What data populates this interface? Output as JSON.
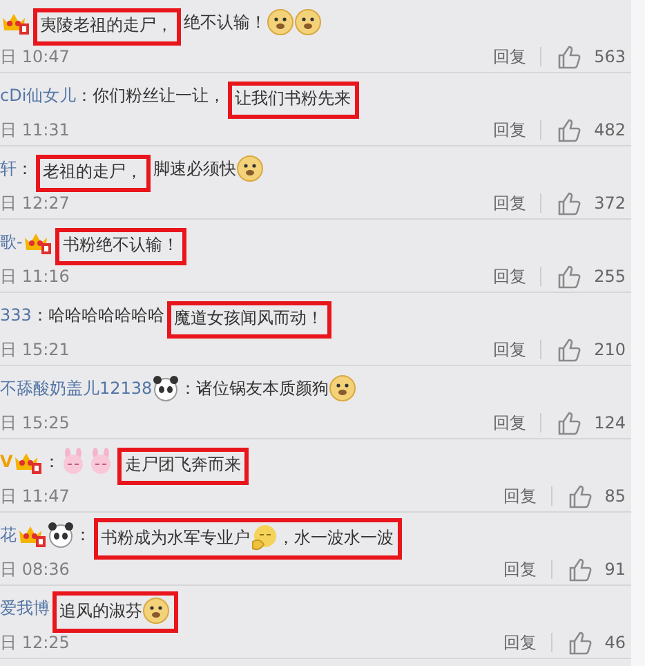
{
  "comments": [
    {
      "line": [
        {
          "highlighted": false,
          "items": [
            {
              "kind": "crown"
            }
          ]
        },
        {
          "highlighted": true,
          "items": [
            {
              "kind": "text",
              "text": "夷陵老祖的走尸，"
            }
          ]
        },
        {
          "highlighted": false,
          "items": [
            {
              "kind": "text",
              "text": "绝不认输！"
            },
            {
              "kind": "doge"
            },
            {
              "kind": "doge"
            }
          ]
        }
      ],
      "time": "日 10:47",
      "reply": "回复",
      "likes": "563"
    },
    {
      "line": [
        {
          "highlighted": false,
          "items": [
            {
              "kind": "user",
              "text": "cDi仙女儿"
            },
            {
              "kind": "text",
              "text": "：你们粉丝让一让，"
            }
          ]
        },
        {
          "highlighted": true,
          "items": [
            {
              "kind": "text",
              "text": "让我们书粉先来"
            }
          ]
        }
      ],
      "time": "日 11:31",
      "reply": "回复",
      "likes": "482"
    },
    {
      "line": [
        {
          "highlighted": false,
          "items": [
            {
              "kind": "user",
              "text": "轩"
            },
            {
              "kind": "text",
              "text": "："
            }
          ]
        },
        {
          "highlighted": true,
          "items": [
            {
              "kind": "text",
              "text": "老祖的走尸，"
            }
          ]
        },
        {
          "highlighted": false,
          "items": [
            {
              "kind": "text",
              "text": "脚速必须快"
            },
            {
              "kind": "doge"
            }
          ]
        }
      ],
      "time": "日 12:27",
      "reply": "回复",
      "likes": "372"
    },
    {
      "line": [
        {
          "highlighted": false,
          "items": [
            {
              "kind": "user",
              "text": "歌-"
            },
            {
              "kind": "crown"
            }
          ]
        },
        {
          "highlighted": true,
          "items": [
            {
              "kind": "text",
              "text": "书粉绝不认输！"
            }
          ]
        }
      ],
      "time": "日 11:16",
      "reply": "回复",
      "likes": "255"
    },
    {
      "line": [
        {
          "highlighted": false,
          "items": [
            {
              "kind": "user",
              "text": "333"
            },
            {
              "kind": "text",
              "text": "：哈哈哈哈哈哈哈"
            }
          ]
        },
        {
          "highlighted": true,
          "items": [
            {
              "kind": "text",
              "text": "魔道女孩闻风而动！"
            }
          ]
        }
      ],
      "time": "日 15:21",
      "reply": "回复",
      "likes": "210"
    },
    {
      "line": [
        {
          "highlighted": false,
          "items": [
            {
              "kind": "user",
              "text": "不舔酸奶盖儿12138"
            },
            {
              "kind": "panda"
            },
            {
              "kind": "text",
              "text": "：诸位锅友本质颜狗"
            },
            {
              "kind": "doge"
            }
          ]
        }
      ],
      "time": "日 15:25",
      "reply": "回复",
      "likes": "124"
    },
    {
      "line": [
        {
          "highlighted": false,
          "items": [
            {
              "kind": "vip",
              "text": "V"
            },
            {
              "kind": "crown"
            },
            {
              "kind": "text",
              "text": "："
            },
            {
              "kind": "rabbit"
            },
            {
              "kind": "rabbit"
            }
          ]
        },
        {
          "highlighted": true,
          "items": [
            {
              "kind": "text",
              "text": "走尸团飞奔而来"
            }
          ]
        }
      ],
      "time": "日 11:47",
      "reply": "回复",
      "likes": "85"
    },
    {
      "line": [
        {
          "highlighted": false,
          "items": [
            {
              "kind": "user",
              "text": "花"
            },
            {
              "kind": "crown"
            },
            {
              "kind": "panda"
            },
            {
              "kind": "text",
              "text": "："
            }
          ]
        },
        {
          "highlighted": true,
          "items": [
            {
              "kind": "text",
              "text": "书粉成为水军专业户"
            },
            {
              "kind": "shy"
            },
            {
              "kind": "text",
              "text": "，水一波水一波"
            }
          ]
        }
      ],
      "time": "日 08:36",
      "reply": "回复",
      "likes": "91"
    },
    {
      "line": [
        {
          "highlighted": false,
          "items": [
            {
              "kind": "user",
              "text": "爱我博"
            }
          ]
        },
        {
          "highlighted": true,
          "items": [
            {
              "kind": "text",
              "text": "追风的淑芬"
            },
            {
              "kind": "doge"
            }
          ]
        }
      ],
      "time": "日 12:25",
      "reply": "回复",
      "likes": "46"
    }
  ]
}
